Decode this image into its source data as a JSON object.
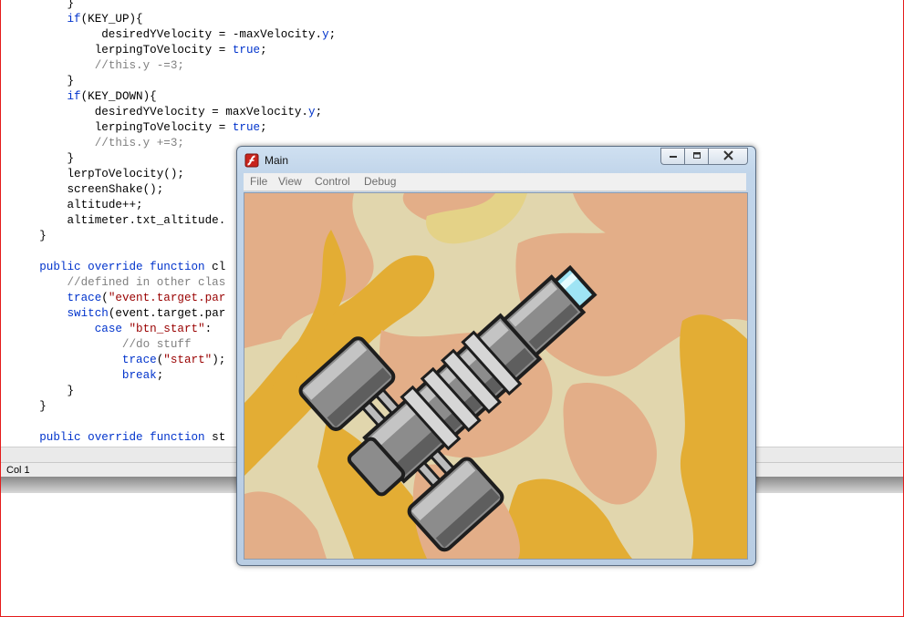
{
  "editor": {
    "lines": [
      {
        "indent": "        ",
        "parts": [
          {
            "t": "}",
            "c": "p"
          }
        ]
      },
      {
        "indent": "        ",
        "parts": [
          {
            "t": "if",
            "c": "kw"
          },
          {
            "t": "(KEY_UP){",
            "c": "p"
          }
        ]
      },
      {
        "indent": "             ",
        "parts": [
          {
            "t": "desiredYVelocity = -maxVelocity.",
            "c": "p"
          },
          {
            "t": "y",
            "c": "prop"
          },
          {
            "t": ";",
            "c": "p"
          }
        ]
      },
      {
        "indent": "            ",
        "parts": [
          {
            "t": "lerpingToVelocity = ",
            "c": "p"
          },
          {
            "t": "true",
            "c": "kw"
          },
          {
            "t": ";",
            "c": "p"
          }
        ]
      },
      {
        "indent": "            ",
        "parts": [
          {
            "t": "//this.y -=3;",
            "c": "cmt"
          }
        ]
      },
      {
        "indent": "        ",
        "parts": [
          {
            "t": "}",
            "c": "p"
          }
        ]
      },
      {
        "indent": "        ",
        "parts": [
          {
            "t": "if",
            "c": "kw"
          },
          {
            "t": "(KEY_DOWN){",
            "c": "p"
          }
        ]
      },
      {
        "indent": "            ",
        "parts": [
          {
            "t": "desiredYVelocity = maxVelocity.",
            "c": "p"
          },
          {
            "t": "y",
            "c": "prop"
          },
          {
            "t": ";",
            "c": "p"
          }
        ]
      },
      {
        "indent": "            ",
        "parts": [
          {
            "t": "lerpingToVelocity = ",
            "c": "p"
          },
          {
            "t": "true",
            "c": "kw"
          },
          {
            "t": ";",
            "c": "p"
          }
        ]
      },
      {
        "indent": "            ",
        "parts": [
          {
            "t": "//this.y +=3;",
            "c": "cmt"
          }
        ]
      },
      {
        "indent": "        ",
        "parts": [
          {
            "t": "}",
            "c": "p"
          }
        ]
      },
      {
        "indent": "        ",
        "parts": [
          {
            "t": "lerpToVelocity();",
            "c": "p"
          }
        ]
      },
      {
        "indent": "        ",
        "parts": [
          {
            "t": "screenShake();",
            "c": "p"
          }
        ]
      },
      {
        "indent": "        ",
        "parts": [
          {
            "t": "altitude++;",
            "c": "p"
          }
        ]
      },
      {
        "indent": "        ",
        "parts": [
          {
            "t": "altimeter.txt_altitude.",
            "c": "p"
          }
        ]
      },
      {
        "indent": "    ",
        "parts": [
          {
            "t": "}",
            "c": "p"
          }
        ]
      },
      {
        "indent": "",
        "parts": []
      },
      {
        "indent": "    ",
        "parts": [
          {
            "t": "public override function",
            "c": "kw"
          },
          {
            "t": " cl",
            "c": "p"
          }
        ]
      },
      {
        "indent": "        ",
        "parts": [
          {
            "t": "//defined in other clas",
            "c": "cmt"
          }
        ]
      },
      {
        "indent": "        ",
        "parts": [
          {
            "t": "trace",
            "c": "kw"
          },
          {
            "t": "(",
            "c": "p"
          },
          {
            "t": "\"event.target.par",
            "c": "str"
          }
        ]
      },
      {
        "indent": "        ",
        "parts": [
          {
            "t": "switch",
            "c": "kw"
          },
          {
            "t": "(event.target.par",
            "c": "p"
          }
        ]
      },
      {
        "indent": "            ",
        "parts": [
          {
            "t": "case",
            "c": "kw"
          },
          {
            "t": " ",
            "c": "p"
          },
          {
            "t": "\"btn_start\"",
            "c": "str"
          },
          {
            "t": ":",
            "c": "p"
          }
        ]
      },
      {
        "indent": "                ",
        "parts": [
          {
            "t": "//do stuff",
            "c": "cmt"
          }
        ]
      },
      {
        "indent": "                ",
        "parts": [
          {
            "t": "trace",
            "c": "kw"
          },
          {
            "t": "(",
            "c": "p"
          },
          {
            "t": "\"start\"",
            "c": "str"
          },
          {
            "t": ");",
            "c": "p"
          }
        ]
      },
      {
        "indent": "                ",
        "parts": [
          {
            "t": "break",
            "c": "kw"
          },
          {
            "t": ";",
            "c": "p"
          }
        ]
      },
      {
        "indent": "        ",
        "parts": [
          {
            "t": "}",
            "c": "p"
          }
        ]
      },
      {
        "indent": "    ",
        "parts": [
          {
            "t": "}",
            "c": "p"
          }
        ]
      },
      {
        "indent": "",
        "parts": []
      },
      {
        "indent": "    ",
        "parts": [
          {
            "t": "public override function",
            "c": "kw"
          },
          {
            "t": " st",
            "c": "p"
          }
        ]
      }
    ]
  },
  "statusbar": {
    "column": "Col 1"
  },
  "player_window": {
    "title": "Main",
    "icon": "flash-player-icon",
    "controls": {
      "minimize": "minimize-icon",
      "restore": "restore-icon",
      "close": "close-icon"
    },
    "menu": [
      "File",
      "View",
      "Control",
      "Debug"
    ]
  },
  "colors": {
    "keyword": "#0033cc",
    "string": "#990000",
    "comment": "#808080",
    "terrain_base": "#e1d6ad",
    "terrain_salmon": "#e3ae88",
    "terrain_orange": "#e3ad34",
    "frame": "#e41b1b"
  }
}
